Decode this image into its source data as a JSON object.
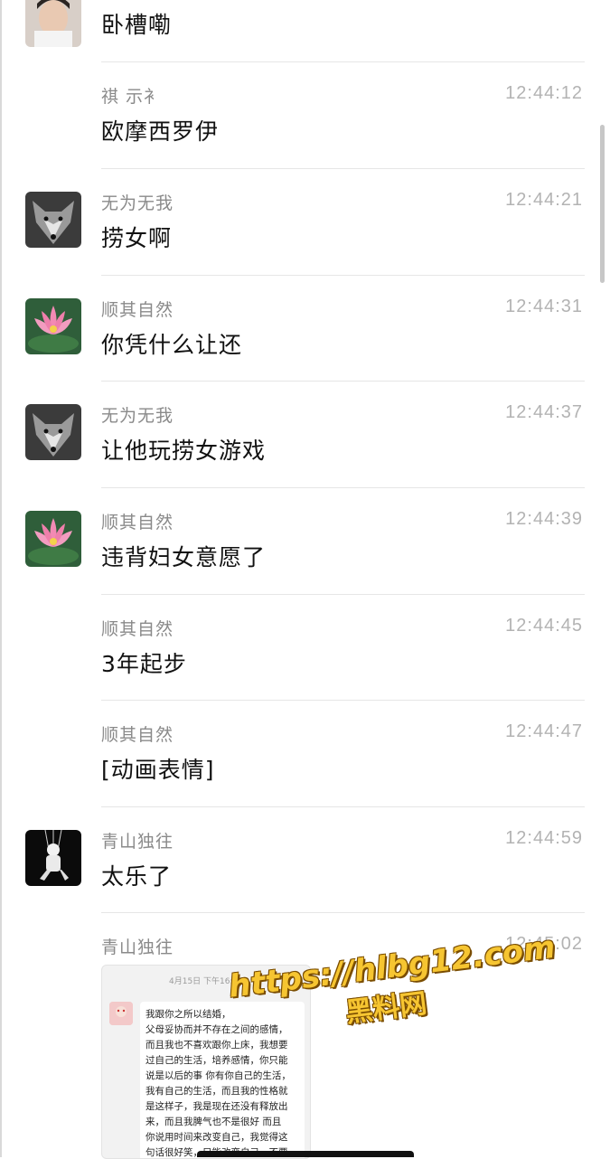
{
  "messages": [
    {
      "name": "",
      "time": "",
      "text": "卧槽嘞",
      "avatar": "man"
    },
    {
      "name": "祺 示衤",
      "time": "12:44:12",
      "text": "欧摩西罗伊",
      "avatar": ""
    },
    {
      "name": "无为无我",
      "time": "12:44:21",
      "text": "捞女啊",
      "avatar": "wolf"
    },
    {
      "name": "顺其自然",
      "time": "12:44:31",
      "text": "你凭什么让还",
      "avatar": "lotus"
    },
    {
      "name": "无为无我",
      "time": "12:44:37",
      "text": "让他玩捞女游戏",
      "avatar": "wolf"
    },
    {
      "name": "顺其自然",
      "time": "12:44:39",
      "text": "违背妇女意愿了",
      "avatar": "lotus"
    },
    {
      "name": "顺其自然",
      "time": "12:44:45",
      "text": "3年起步",
      "avatar": ""
    },
    {
      "name": "顺其自然",
      "time": "12:44:47",
      "text": "[动画表情]",
      "avatar": ""
    },
    {
      "name": "青山独往",
      "time": "12:44:59",
      "text": "太乐了",
      "avatar": "astronaut"
    },
    {
      "name": "青山独往",
      "time": "12:45:02",
      "text": "",
      "avatar": ""
    }
  ],
  "image_message": {
    "date": "4月15日 下午16:01",
    "lines": [
      "我跟你之所以结婚，",
      "父母妥协而并不存在之间的感情，",
      "而且我也不喜欢跟你上床，我想要",
      "过自己的生活，培养感情，你只能",
      "说是以后的事 你有你自己的生活，",
      "我有自己的生活，而且我的性格就",
      "是这样子，我是现在还没有释放出",
      "来，而且我脾气也不是很好 而且",
      "你说用时间来改变自己，我觉得这",
      "句话很好笑，只能改变自己，不要"
    ]
  },
  "watermark": {
    "url": "https://hlbg12.com",
    "label": "黑料网"
  },
  "colors": {
    "name": "#8a8a8a",
    "time": "#b3b3b3",
    "watermark": "#f6c531"
  }
}
